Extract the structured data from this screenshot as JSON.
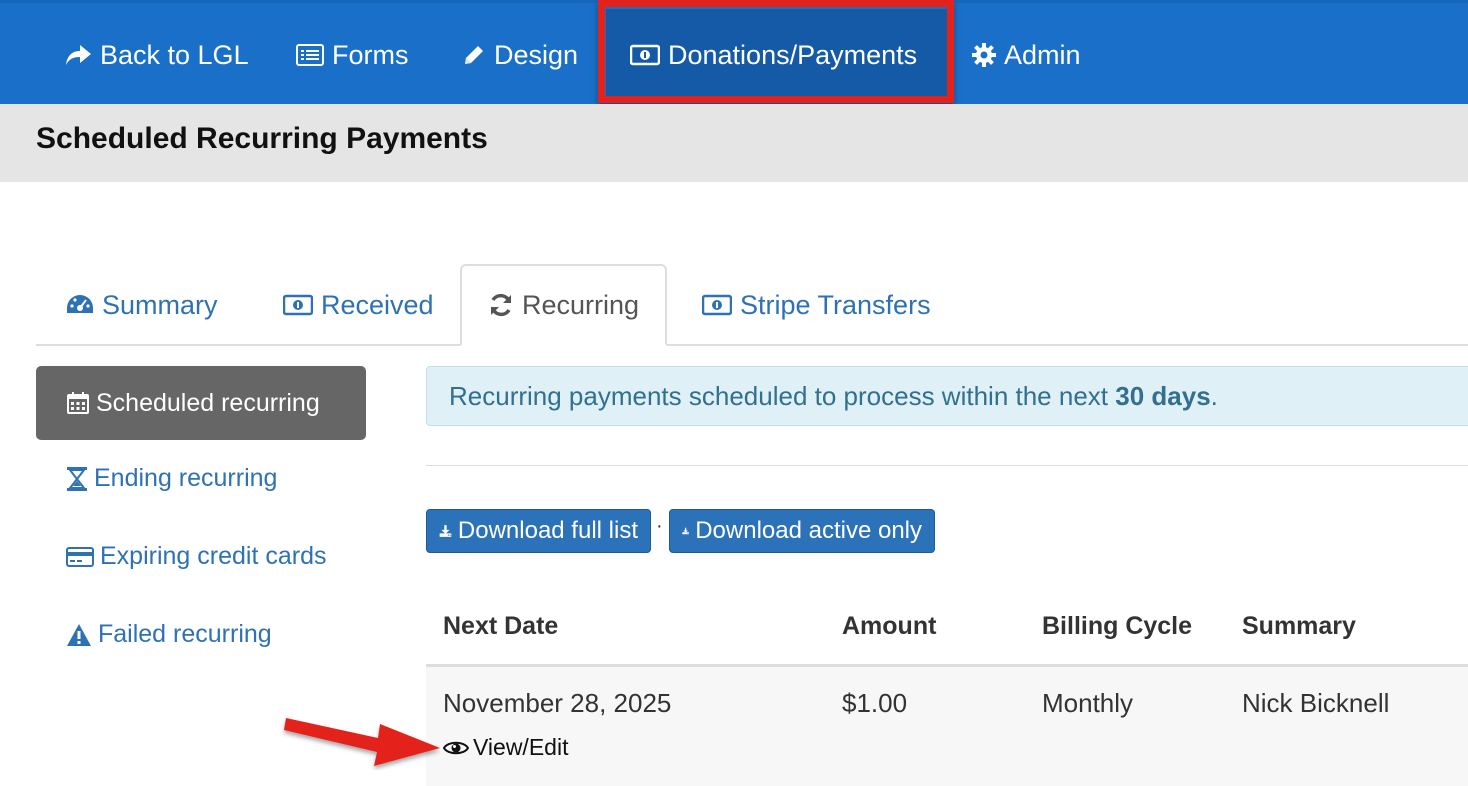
{
  "nav": {
    "back": "Back to LGL",
    "forms": "Forms",
    "design": "Design",
    "donations": "Donations/Payments",
    "admin": "Admin"
  },
  "page": {
    "title": "Scheduled Recurring Payments"
  },
  "tabs": [
    {
      "label": "Summary"
    },
    {
      "label": "Received"
    },
    {
      "label": "Recurring"
    },
    {
      "label": "Stripe Transfers"
    }
  ],
  "sidebar": {
    "items": [
      {
        "label": "Scheduled recurring"
      },
      {
        "label": "Ending recurring"
      },
      {
        "label": "Expiring credit cards"
      },
      {
        "label": "Failed recurring"
      }
    ]
  },
  "alert": {
    "prefix": "Recurring payments scheduled to process within the next ",
    "emphasis": "30 days",
    "suffix": "."
  },
  "buttons": {
    "download_full": "Download full list",
    "separator": "·",
    "download_active": "Download active only"
  },
  "table": {
    "headers": [
      "Next Date",
      "Amount",
      "Billing Cycle",
      "Summary"
    ],
    "rows": [
      {
        "next_date": "November 28, 2025",
        "amount": "$1.00",
        "billing_cycle": "Monthly",
        "summary": "Nick Bicknell",
        "action": "View/Edit"
      }
    ]
  },
  "colors": {
    "nav_bg": "#1a6fc9",
    "highlight": "#e3221b",
    "link": "#2e72b4"
  }
}
